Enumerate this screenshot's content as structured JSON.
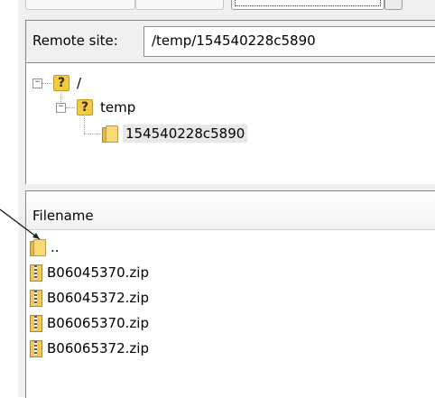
{
  "remote_site": {
    "label": "Remote site:",
    "path": "/temp/154540228c5890"
  },
  "tree": {
    "root_label": "/",
    "child_label": "temp",
    "leaf_label": "154540228c5890"
  },
  "file_list": {
    "column_header": "Filename",
    "parent_entry": "..",
    "files": [
      "B06045370.zip",
      "B06045372.zip",
      "B06065370.zip",
      "B06065372.zip"
    ]
  },
  "colors": {
    "pane_border": "#828790",
    "frame_background": "#f0f0f0",
    "folder_yellow": "#f7d978"
  },
  "icons": [
    "question-icon",
    "folder-icon",
    "zip-file-icon",
    "expand-collapse-icon"
  ]
}
